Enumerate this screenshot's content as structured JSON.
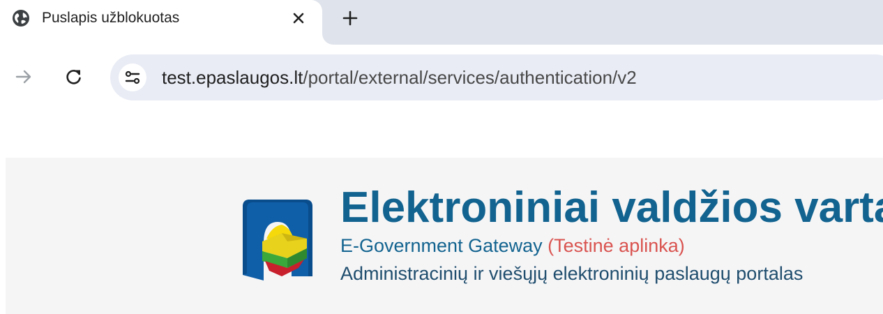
{
  "browser": {
    "tab": {
      "title": "Puslapis užblokuotas",
      "favicon": "globe-icon"
    },
    "address": {
      "host": "test.epaslaugos.lt",
      "path": "/portal/external/services/authentication/v2"
    }
  },
  "page": {
    "title": "Elektroniniai valdžios vartai",
    "subtitle": "E-Government Gateway",
    "environment": "(Testinė aplinka)",
    "description": "Administracinių ir viešųjų elektroninių paslaugų portalas"
  },
  "colors": {
    "brand_blue": "#12638f",
    "environment_red": "#d9534f",
    "tabstrip": "#dfe3eb",
    "omnibox": "#e9ecf5",
    "header_bg": "#f5f5f6"
  }
}
